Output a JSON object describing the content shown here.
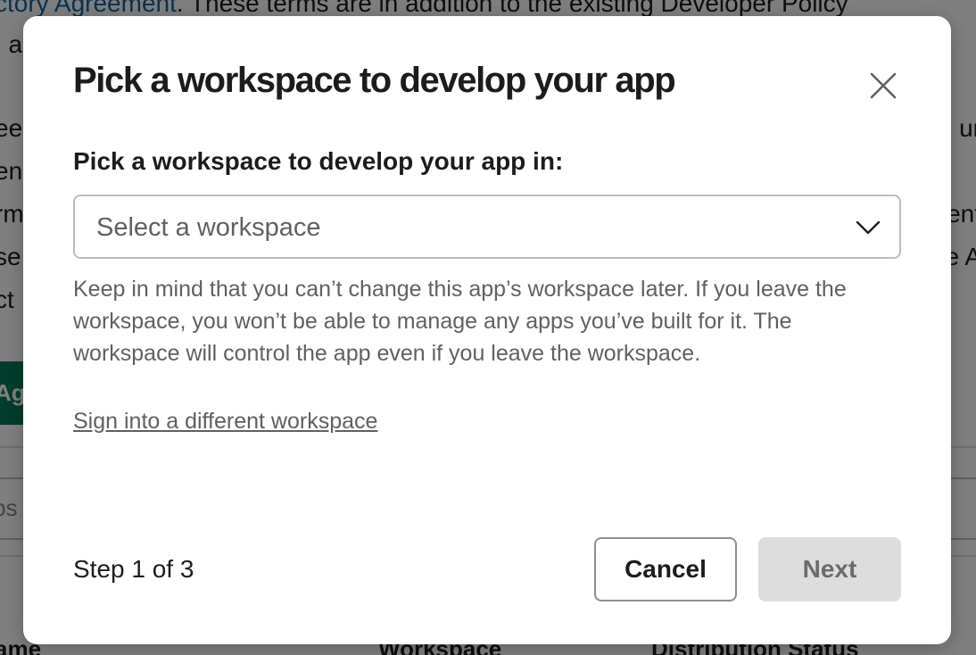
{
  "background": {
    "line1_link": "ctory Agreement",
    "line1_rest": ". These terms are in addition to the existing Developer Policy",
    "line2": ", a",
    "line3_left": "ee",
    "line3_right": "ur",
    "line4_left": "en",
    "line5_left": "rm",
    "line5_right": "ent",
    "line6_left": "se",
    "line6_right": "e A",
    "line7_left": "ct",
    "agree_button_fragment": "Agr",
    "search_fragment": "ps",
    "col_name": "ame",
    "col_workspace": "Workspace",
    "col_distribution": "Distribution Status"
  },
  "modal": {
    "title": "Pick a workspace to develop your app",
    "close_icon": "close-icon",
    "field_label": "Pick a workspace to develop your app in:",
    "select": {
      "placeholder": "Select a workspace",
      "icon": "chevron-down-icon"
    },
    "help_text": "Keep in mind that you can’t change this app’s workspace later. If you leave the workspace, you won’t be able to manage any apps you’ve built for it. The workspace will control the app even if you leave the workspace.",
    "switch_link": "Sign into a different workspace",
    "footer": {
      "step": "Step 1 of 3",
      "cancel_label": "Cancel",
      "next_label": "Next"
    }
  },
  "colors": {
    "text_primary": "#1d1c1d",
    "text_secondary": "#616061",
    "link": "#1264a3",
    "brand_green": "#007a5a",
    "disabled_button": "#dddddd"
  }
}
